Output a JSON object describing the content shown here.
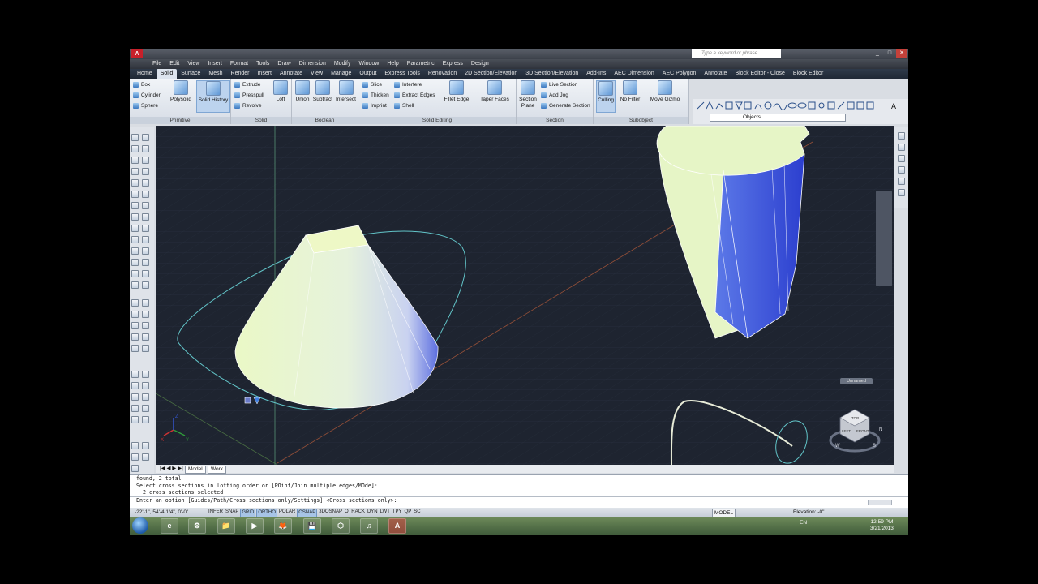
{
  "title_bar": {
    "app_logo": "A",
    "search_placeholder": "Type a keyword or phrase",
    "window_controls": [
      "_",
      "□",
      "✕"
    ]
  },
  "menu": [
    "File",
    "Edit",
    "View",
    "Insert",
    "Format",
    "Tools",
    "Draw",
    "Dimension",
    "Modify",
    "Window",
    "Help",
    "Parametric",
    "Express",
    "Design"
  ],
  "ribbon_tabs": [
    "Home",
    "Solid",
    "Surface",
    "Mesh",
    "Render",
    "Insert",
    "Annotate",
    "View",
    "Manage",
    "Output",
    "Express Tools",
    "Renovation",
    "2D Section/Elevation",
    "3D Section/Elevation",
    "Add-Ins",
    "AEC Dimension",
    "AEC Polygon",
    "Annotate",
    "Block Editor - Close",
    "Block Editor"
  ],
  "ribbon_active_tab": "Solid",
  "ribbon": {
    "primitive": {
      "title": "Primitive",
      "box": "Box",
      "cylinder": "Cylinder",
      "sphere": "Sphere",
      "polysolid": "Polysolid",
      "solid_history": "Solid History"
    },
    "solid": {
      "title": "Solid",
      "extrude": "Extrude",
      "presspull": "Presspull",
      "revolve": "Revolve",
      "loft": "Loft"
    },
    "boolean": {
      "title": "Boolean",
      "union": "Union",
      "subtract": "Subtract",
      "intersect": "Intersect"
    },
    "solid_editing": {
      "title": "Solid Editing",
      "slice": "Slice",
      "thicken": "Thicken",
      "imprint": "Imprint",
      "interfere": "Interfere",
      "extract_edges": "Extract Edges",
      "shell": "Shell",
      "fillet_edge": "Fillet Edge",
      "taper_faces": "Taper Faces"
    },
    "section": {
      "title": "Section",
      "section_plane_1": "Section",
      "section_plane_2": "Plane",
      "live_section": "Live Section",
      "add_jog": "Add Jog",
      "generate_section": "Generate Section"
    },
    "subobject": {
      "title": "Subobject",
      "culling": "Culling",
      "no_filter": "No Filter",
      "move_gizmo": "Move Gizmo"
    }
  },
  "layer_combo": "Objects",
  "viewport": {
    "unnamed_label": "Unnamed",
    "viewcube_labels": {
      "top": "TOP",
      "left": "LEFT",
      "front": "FRONT",
      "north": "N",
      "west": "W",
      "south": "S"
    },
    "axis_labels": {
      "x": "X",
      "y": "Y",
      "z": "Z"
    }
  },
  "model_tabs": [
    "Model",
    "Work"
  ],
  "command_lines": [
    "found, 2 total",
    "Select cross sections in lofting order or [POint/Join multiple edges/MOde]:",
    "  2 cross sections selected",
    "Enter an option [Guides/Path/Cross sections only/Settings] <Cross sections only>:"
  ],
  "status": {
    "coords": "-22'-1\", 54'-4 1/4\", 0'-0\"",
    "toggles": [
      {
        "label": "INFER",
        "on": false
      },
      {
        "label": "SNAP",
        "on": false
      },
      {
        "label": "GRID",
        "on": true
      },
      {
        "label": "ORTHO",
        "on": true
      },
      {
        "label": "POLAR",
        "on": false
      },
      {
        "label": "OSNAP",
        "on": true
      },
      {
        "label": "3DOSNAP",
        "on": false
      },
      {
        "label": "OTRACK",
        "on": false
      },
      {
        "label": "DYN",
        "on": false
      },
      {
        "label": "LWT",
        "on": false
      },
      {
        "label": "TPY",
        "on": false
      },
      {
        "label": "QP",
        "on": false
      },
      {
        "label": "SC",
        "on": false
      }
    ],
    "model_button": "MODEL",
    "elevation": "Elevation: -0\""
  },
  "taskbar": {
    "apps": [
      "e",
      "⚙",
      "📁",
      "▶",
      "🦊",
      "💾",
      "⬡",
      "♫",
      "A"
    ],
    "language": "EN",
    "time": "12:59 PM",
    "date": "3/21/2013"
  },
  "colors": {
    "viewport_bg": "#1e2430",
    "solid_face_light": "#e6f8c8",
    "solid_face_blue": "#3b52d8",
    "ribbon_accent": "#bcd3ee"
  }
}
